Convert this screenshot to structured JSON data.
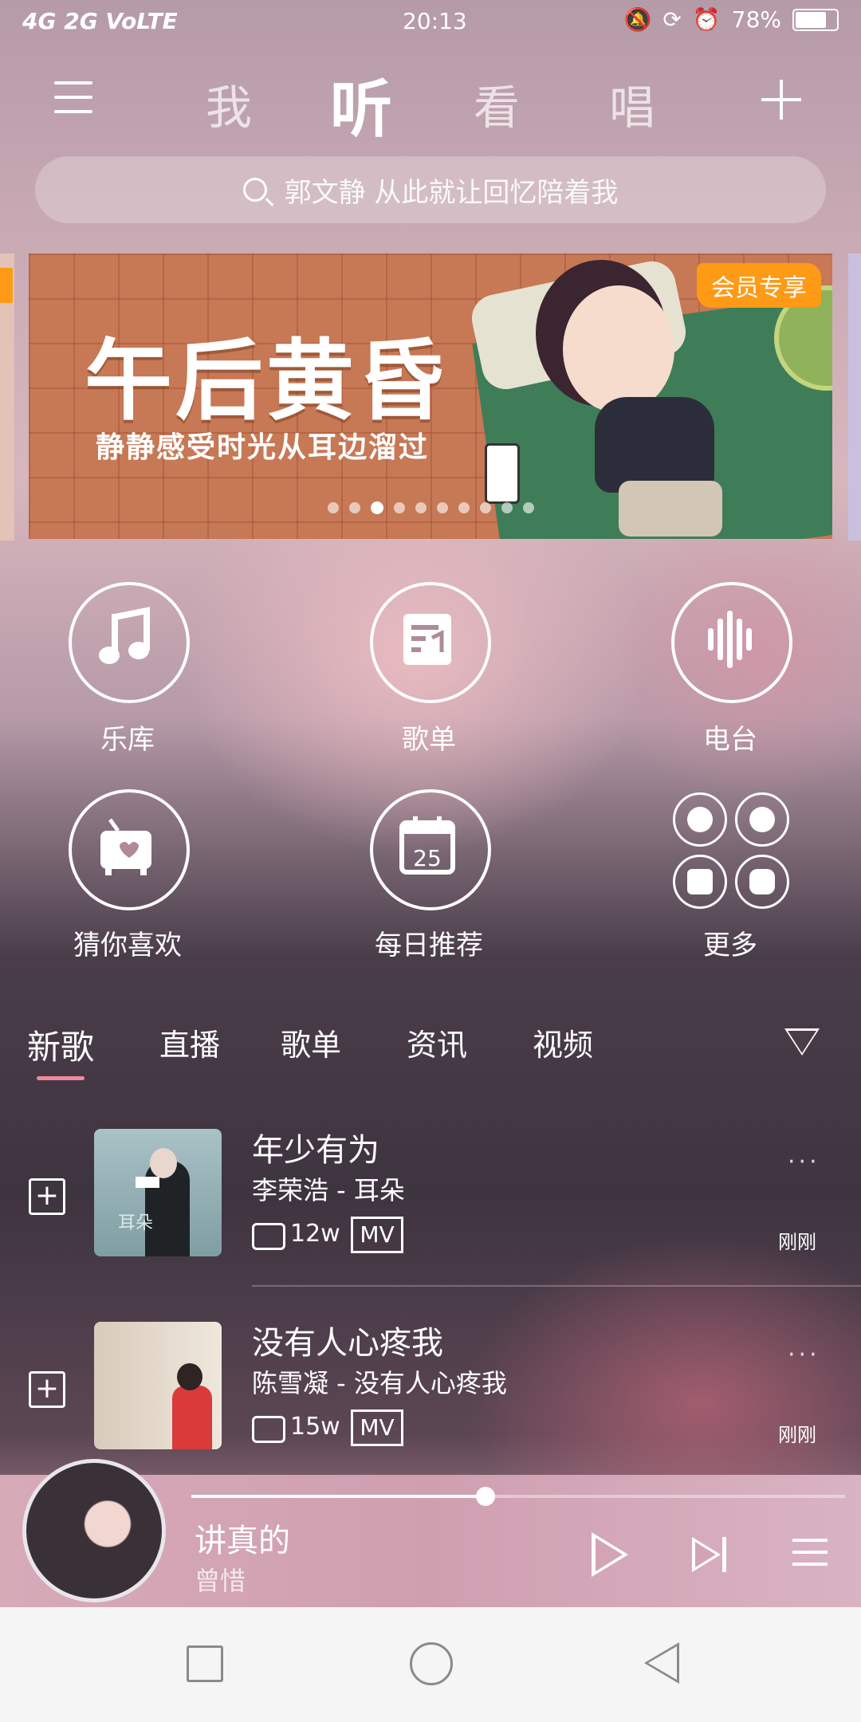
{
  "status_bar": {
    "network": "4G 2G VoLTE",
    "time": "20:13",
    "battery": "78%"
  },
  "top_nav": {
    "tabs": [
      {
        "label": "我",
        "active": false
      },
      {
        "label": "听",
        "active": true
      },
      {
        "label": "看",
        "active": false
      },
      {
        "label": "唱",
        "active": false
      }
    ]
  },
  "search": {
    "placeholder": "郭文静 从此就让回忆陪着我"
  },
  "banner": {
    "title": "午后黄昏",
    "subtitle": "静静感受时光从耳边溜过",
    "badge": "会员专享",
    "page_count": 10,
    "active_page": 3
  },
  "shortcuts": [
    {
      "label": "乐库",
      "icon": "music-note-icon"
    },
    {
      "label": "歌单",
      "icon": "playlist-icon"
    },
    {
      "label": "电台",
      "icon": "sound-wave-icon"
    },
    {
      "label": "猜你喜欢",
      "icon": "radio-heart-icon"
    },
    {
      "label": "每日推荐",
      "icon": "calendar-icon",
      "calendar_day": "25"
    },
    {
      "label": "更多",
      "icon": "more-grid-icon"
    }
  ],
  "sub_tabs": [
    {
      "label": "新歌",
      "active": true
    },
    {
      "label": "直播",
      "active": false
    },
    {
      "label": "歌单",
      "active": false
    },
    {
      "label": "资讯",
      "active": false
    },
    {
      "label": "视频",
      "active": false
    }
  ],
  "songs": [
    {
      "title": "年少有为",
      "artist_album": "李荣浩 - 耳朵",
      "comments": "12w",
      "mv": "MV",
      "time": "刚刚",
      "more": "···",
      "cover_text": "耳朵"
    },
    {
      "title": "没有人心疼我",
      "artist_album": "陈雪凝 - 没有人心疼我",
      "comments": "15w",
      "mv": "MV",
      "time": "刚刚",
      "more": "···"
    }
  ],
  "player": {
    "title": "讲真的",
    "artist": "曾惜",
    "progress": 0.45
  },
  "colors": {
    "accent": "#f08a9a",
    "vip_badge": "#ff9a17"
  }
}
